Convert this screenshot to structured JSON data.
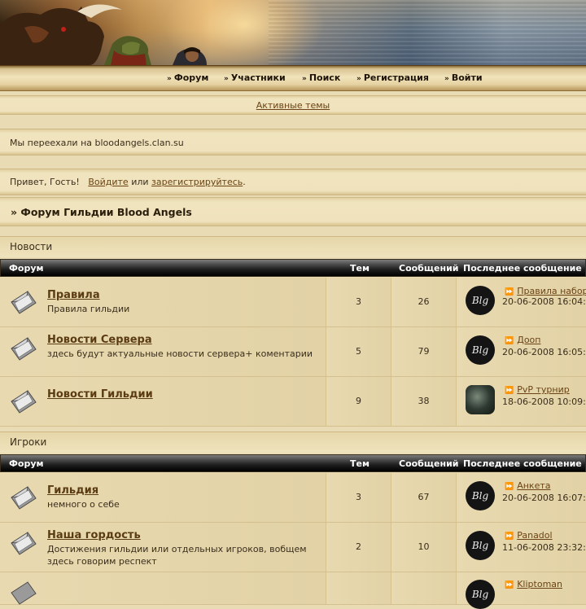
{
  "nav": {
    "items": [
      "Форум",
      "Участники",
      "Поиск",
      "Регистрация",
      "Войти"
    ]
  },
  "active_topics": "Активные темы",
  "notice": "Мы переехали на bloodangels.clan.su",
  "greeting": {
    "hello": "Привет, Гость!",
    "login": "Войдите",
    "or": "или",
    "register": "зарегистрируйтесь",
    "end": "."
  },
  "forum_title": "» Форум Гильдии Blood Angels",
  "table_headers": {
    "forum": "Форум",
    "topics": "Тем",
    "posts": "Сообщений",
    "last": "Последнее сообщение"
  },
  "categories": [
    {
      "name": "Новости",
      "forums": [
        {
          "name": "Правила",
          "desc": "Правила гильдии",
          "topics": "3",
          "posts": "26",
          "last_title": "Правила набор",
          "last_date": "20-06-2008 16:04:",
          "avatar": "Blg"
        },
        {
          "name": "Новости Сервера",
          "desc": "здесь будут актуальные новости сервера+ коментарии",
          "topics": "5",
          "posts": "79",
          "last_title": "Доoп",
          "last_date": "20-06-2008 16:05:",
          "avatar": "Blg"
        },
        {
          "name": "Новости Гильдии",
          "desc": "",
          "topics": "9",
          "posts": "38",
          "last_title": "PvP турнир",
          "last_date": "18-06-2008 10:09:",
          "avatar": ""
        }
      ]
    },
    {
      "name": "Игроки",
      "forums": [
        {
          "name": "Гильдия",
          "desc": "немного о себе",
          "topics": "3",
          "posts": "67",
          "last_title": "Анкета",
          "last_date": "20-06-2008 16:07:",
          "avatar": "Blg"
        },
        {
          "name": "Наша гордость",
          "desc": "Достижения гильдии или отдельных игроков, вобщем здесь говорим респект",
          "topics": "2",
          "posts": "10",
          "last_title": "Panadol",
          "last_date": "11-06-2008 23:32:",
          "avatar": "Blg"
        },
        {
          "name": "",
          "desc": "",
          "topics": "",
          "posts": "",
          "last_title": "Kliptoman",
          "last_date": "",
          "avatar": "Blg"
        }
      ]
    }
  ],
  "colors": {
    "accent": "#6b4415",
    "header_bar": "#000000",
    "parchment": "#e9dcb5"
  },
  "icons": {
    "forum": "envelope-icon",
    "nav": "double-chevron-icon",
    "last_post": "go-to-post-icon"
  }
}
